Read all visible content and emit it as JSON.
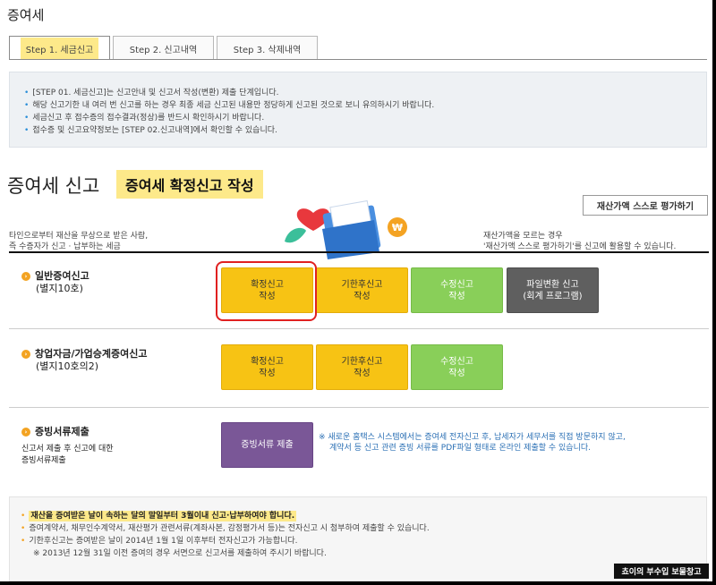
{
  "page": {
    "title": "증여세"
  },
  "tabs": [
    {
      "label": "Step 1. 세금신고"
    },
    {
      "label": "Step 2. 신고내역"
    },
    {
      "label": "Step 3. 삭제내역"
    }
  ],
  "info": [
    "[STEP 01. 세금신고]는 신고안내 및 신고서 작성(변환) 제출 단계입니다.",
    "해당 신고기한 내 여러 번 신고를 하는 경우 최종 세금 신고된 내용만 정당하게 신고된 것으로 보니 유의하시기 바랍니다.",
    "세금신고 후 접수증의 접수결과(정상)를 반드시 확인하시기 바랍니다.",
    "접수증 및 신고요약정보는 [STEP 02.신고내역]에서 확인할 수 있습니다."
  ],
  "section": {
    "title": "증여세 신고",
    "badge": "증여세 확정신고 작성",
    "eval_button": "재산가액 스스로 평가하기"
  },
  "desc": {
    "left": [
      "타인으로부터 재산을 무상으로 받은 사람,",
      "즉 수증자가 신고 · 납부하는 세금"
    ],
    "right": [
      "재산가액을 모르는 경우",
      "'재산가액 스스로 평가하기'를 신고에 활용할 수 있습니다."
    ]
  },
  "categories": {
    "general": {
      "title": "일반증여신고",
      "sub": "(별지10호)"
    },
    "startup": {
      "title": "창업자금/가업승계증여신고",
      "sub": "(별지10호의2)"
    },
    "proof": {
      "title": "증빙서류제출",
      "sub1": "신고서 제출 후 신고에 대한",
      "sub2": "증빙서류제출"
    }
  },
  "buttons": {
    "general": [
      {
        "l1": "확정신고",
        "l2": "작성"
      },
      {
        "l1": "기한후신고",
        "l2": "작성"
      },
      {
        "l1": "수정신고",
        "l2": "작성"
      },
      {
        "l1": "파일변환 신고",
        "l2": "(회계 프로그램)"
      }
    ],
    "startup": [
      {
        "l1": "확정신고",
        "l2": "작성"
      },
      {
        "l1": "기한후신고",
        "l2": "작성"
      },
      {
        "l1": "수정신고",
        "l2": "작성"
      }
    ],
    "proof": "증빙서류 제출"
  },
  "notice": [
    "※ 새로운 홈택스 시스템에서는 증여세 전자신고 후, 납세자가 세무서를 직접 방문하지 않고,",
    "계약서 등 신고 관련 증빙 서류를 PDF파일 형태로 온라인 제출할 수 있습니다."
  ],
  "bottom": [
    "재산을 증여받은 날이 속하는 달의 말일부터 3월이내 신고·납부하여야 합니다.",
    "증여계약서, 채무인수계약서, 재산평가 관련서류(계좌사본, 감정평가서 등)는 전자신고 시 첨부하여 제출할 수 있습니다.",
    "기한후신고는 증여받은 날이 2014년 1월 1일 이후부터 전자신고가 가능합니다.",
    "※ 2013년 12월 31일 이전 증여의 경우 서면으로 신고서를 제출하여 주시기 바랍니다."
  ],
  "watermark": "쵸이의 부수입 보물창고"
}
